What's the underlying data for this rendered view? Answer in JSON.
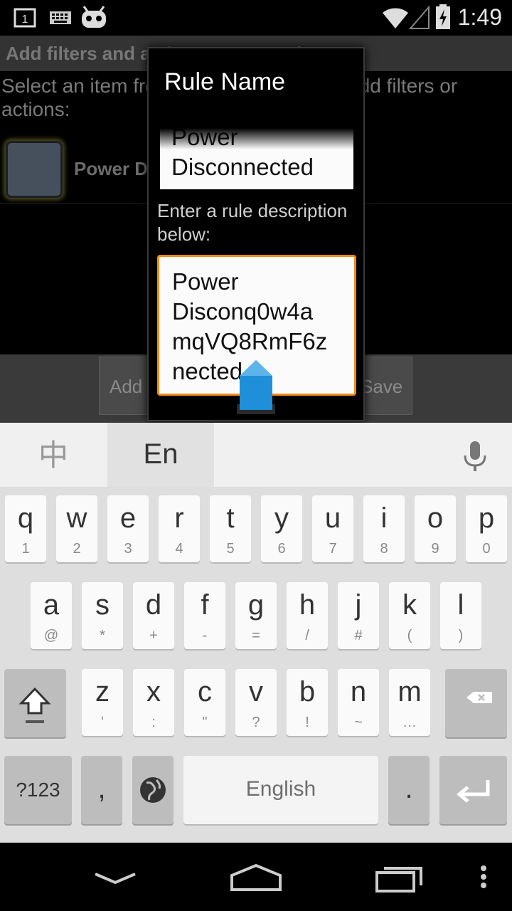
{
  "status_bar": {
    "time": "1:49",
    "notification_badge": "1",
    "icons": [
      "notification-1-icon",
      "keyboard-icon",
      "cyanogen-mascot-icon",
      "wifi-icon",
      "signal-icon",
      "battery-charging-icon"
    ]
  },
  "background": {
    "header": "Add filters and actions to your rule",
    "instructions": "Select an item from the list below, then add filters or actions:",
    "rule_title": "Power Disconnected",
    "add_label": "Add",
    "save_label": "Save"
  },
  "dialog": {
    "title": "Rule Name",
    "name_value": "Power\nDisconnected",
    "description_label": "Enter a rule description below:",
    "description_value": "Power\nDisconq0w4a\nmqVQ8RmF6z\nnected"
  },
  "keyboard": {
    "lang_chinese": "中",
    "lang_english": "En",
    "row1": [
      {
        "main": "q",
        "sub": "1"
      },
      {
        "main": "w",
        "sub": "2"
      },
      {
        "main": "e",
        "sub": "3"
      },
      {
        "main": "r",
        "sub": "4"
      },
      {
        "main": "t",
        "sub": "5"
      },
      {
        "main": "y",
        "sub": "6"
      },
      {
        "main": "u",
        "sub": "7"
      },
      {
        "main": "i",
        "sub": "8"
      },
      {
        "main": "o",
        "sub": "9"
      },
      {
        "main": "p",
        "sub": "0"
      }
    ],
    "row2": [
      {
        "main": "a",
        "sub": "@"
      },
      {
        "main": "s",
        "sub": "*"
      },
      {
        "main": "d",
        "sub": "+"
      },
      {
        "main": "f",
        "sub": "-"
      },
      {
        "main": "g",
        "sub": "="
      },
      {
        "main": "h",
        "sub": "/"
      },
      {
        "main": "j",
        "sub": "#"
      },
      {
        "main": "k",
        "sub": "("
      },
      {
        "main": "l",
        "sub": ")"
      }
    ],
    "row3": [
      {
        "main": "z",
        "sub": "'"
      },
      {
        "main": "x",
        "sub": ":"
      },
      {
        "main": "c",
        "sub": "\""
      },
      {
        "main": "v",
        "sub": "?"
      },
      {
        "main": "b",
        "sub": "!"
      },
      {
        "main": "n",
        "sub": "~"
      },
      {
        "main": "m",
        "sub": "…"
      }
    ],
    "symbols_label": "?123",
    "comma": ",",
    "space_label": "English",
    "period": "."
  },
  "colors": {
    "accent": "#f28b14",
    "handle": "#1e8fd8"
  }
}
